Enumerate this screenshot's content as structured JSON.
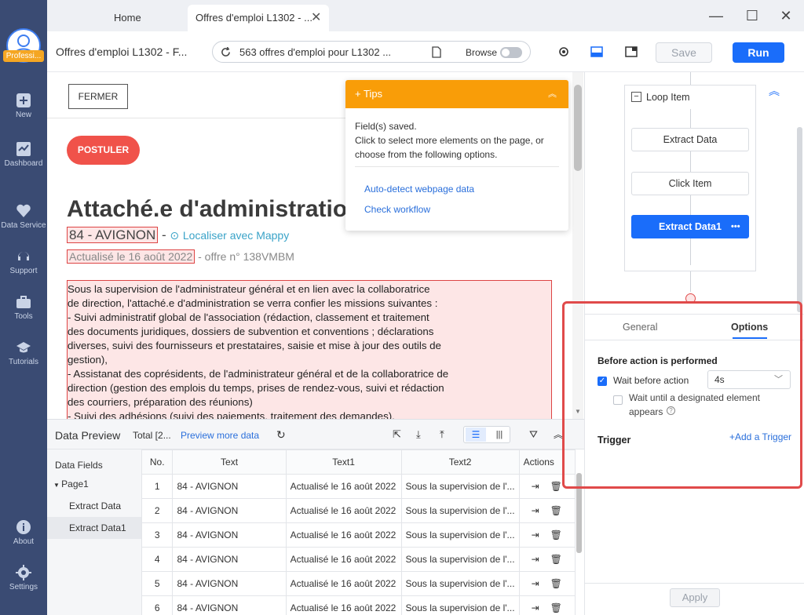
{
  "sidebar": {
    "logo_badge": "Professi...",
    "items": [
      {
        "label": "New",
        "icon": "plus-icon"
      },
      {
        "label": "Dashboard",
        "icon": "chart-icon"
      },
      {
        "label": "Data Service",
        "icon": "heart-icon"
      },
      {
        "label": "Support",
        "icon": "headset-icon"
      },
      {
        "label": "Tools",
        "icon": "toolbox-icon"
      },
      {
        "label": "Tutorials",
        "icon": "graduation-cap-icon"
      },
      {
        "label": "About",
        "icon": "info-icon"
      },
      {
        "label": "Settings",
        "icon": "gear-icon"
      }
    ]
  },
  "tabs": {
    "home": "Home",
    "active": "Offres d'emploi L1302 - ..."
  },
  "toolbar": {
    "page_title": "Offres d'emploi L1302 - F...",
    "url": "563 offres d'emploi pour L1302 ...",
    "browse_label": "Browse",
    "save_label": "Save",
    "run_label": "Run"
  },
  "webpage": {
    "fermer": "FERMER",
    "postuler": "POSTULER",
    "job_title": "Attaché.e d'administration",
    "location": "84 - AVIGNON",
    "mappy": "Localiser avec Mappy",
    "updated": "Actualisé le 16 août 2022",
    "offer_no": "- offre n° 138VMBM",
    "description": [
      "Sous la supervision de l'administrateur général et en lien avec la collaboratrice",
      "de direction, l'attaché.e d'administration se verra confier les missions suivantes :",
      "- Suivi administratif global de l'association (rédaction, classement et traitement",
      "des documents juridiques, dossiers de subvention et conventions ; déclarations",
      "diverses, suivi des fournisseurs et prestataires, saisie et mise à jour des outils de",
      "gestion),",
      "- Assistanat des coprésidents, de l'administrateur général et de la collaboratrice de",
      "direction (gestion des emplois du temps, prises de rendez-vous, suivi et rédaction",
      "des courriers, préparation des réunions)",
      "- Suivi des adhésions (suivi des paiements, traitement des demandes),"
    ]
  },
  "tips": {
    "title": "Tips",
    "body": [
      "Field(s) saved.",
      "Click to select more elements on the page, or",
      "choose from the following options."
    ],
    "link1": "Auto-detect webpage data",
    "link2": "Check workflow"
  },
  "preview": {
    "title": "Data Preview",
    "total": "Total [2...",
    "more": "Preview more data",
    "fields_label": "Data Fields",
    "page": "Page1",
    "field_items": [
      "Extract Data",
      "Extract Data1"
    ],
    "columns": [
      "No.",
      "Text",
      "Text1",
      "Text2",
      "Actions"
    ],
    "rows": [
      [
        "1",
        "84 - AVIGNON",
        "Actualisé le 16 août 2022",
        "Sous la supervision de l'..."
      ],
      [
        "2",
        "84 - AVIGNON",
        "Actualisé le 16 août 2022",
        "Sous la supervision de l'..."
      ],
      [
        "3",
        "84 - AVIGNON",
        "Actualisé le 16 août 2022",
        "Sous la supervision de l'..."
      ],
      [
        "4",
        "84 - AVIGNON",
        "Actualisé le 16 août 2022",
        "Sous la supervision de l'..."
      ],
      [
        "5",
        "84 - AVIGNON",
        "Actualisé le 16 août 2022",
        "Sous la supervision de l'..."
      ],
      [
        "6",
        "84 - AVIGNON",
        "Actualisé le 16 août 2022",
        "Sous la supervision de l'..."
      ]
    ]
  },
  "workflow": {
    "loop": "Loop Item",
    "steps": [
      "Extract Data",
      "Click Item",
      "Extract Data1"
    ],
    "more": "•••"
  },
  "options": {
    "tab_general": "General",
    "tab_options": "Options",
    "before_title": "Before action is performed",
    "wait_before": "Wait before action",
    "wait_value": "4s",
    "wait_until": "Wait until a designated element",
    "appears": "appears",
    "trigger": "Trigger",
    "add_trigger": "+Add a Trigger",
    "apply": "Apply"
  },
  "colors": {
    "accent": "#1a6dfa",
    "sidebar": "#3a4b73",
    "tips": "#f99d08",
    "highlight_border": "#e04a4a"
  }
}
